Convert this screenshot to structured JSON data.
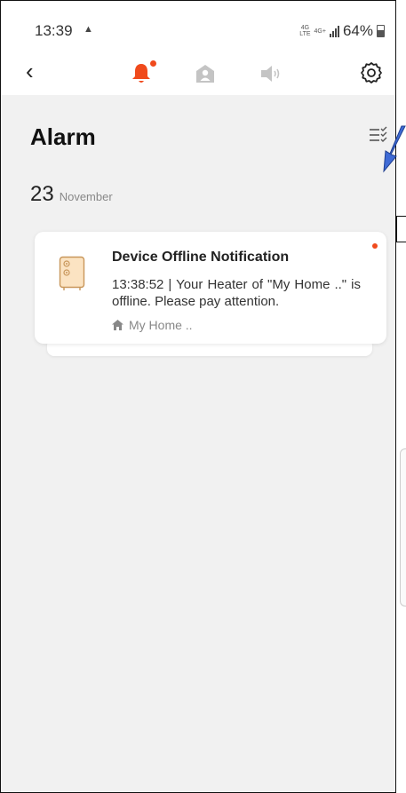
{
  "status_bar": {
    "time": "13:39",
    "network_top": "4G",
    "network_bottom": "LTE",
    "network2_top": "4G+",
    "battery": "64%"
  },
  "nav": {
    "tabs": [
      {
        "name": "alarm",
        "active": true,
        "has_badge": true
      },
      {
        "name": "family",
        "active": false
      },
      {
        "name": "announcement",
        "active": false
      }
    ]
  },
  "page": {
    "title": "Alarm"
  },
  "date_group": {
    "day": "23",
    "month": "November"
  },
  "notification": {
    "title": "Device Offline Notification",
    "message": "13:38:52 | Your Heater of \"My Home ..\" is offline. Please pay attention.",
    "home": "My Home .."
  },
  "colors": {
    "accent": "#f04a1c",
    "background": "#f1f1f1",
    "card": "#ffffff",
    "icon_inactive": "#c4c4c4",
    "annotation_arrow": "#3f6bd6"
  }
}
